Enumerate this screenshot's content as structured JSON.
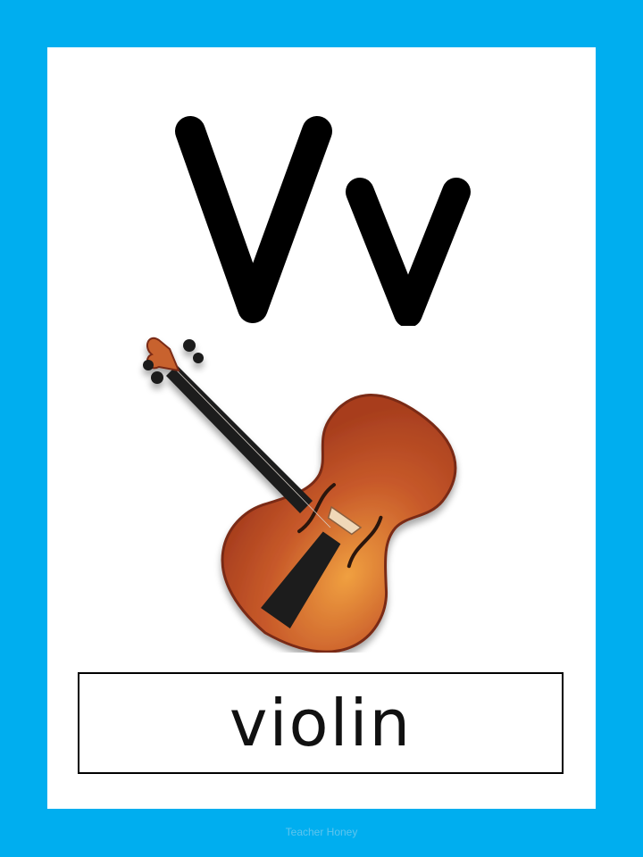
{
  "card": {
    "letters": "Vv",
    "word": "violin",
    "picture": {
      "icon": "violin-icon"
    }
  },
  "watermark": "Teacher Honey",
  "colors": {
    "frame": "#00aeef",
    "card": "#ffffff",
    "text": "#000000",
    "violin_body": "#c0502a",
    "violin_highlight": "#e8903a",
    "violin_edge": "#7a2a12"
  }
}
